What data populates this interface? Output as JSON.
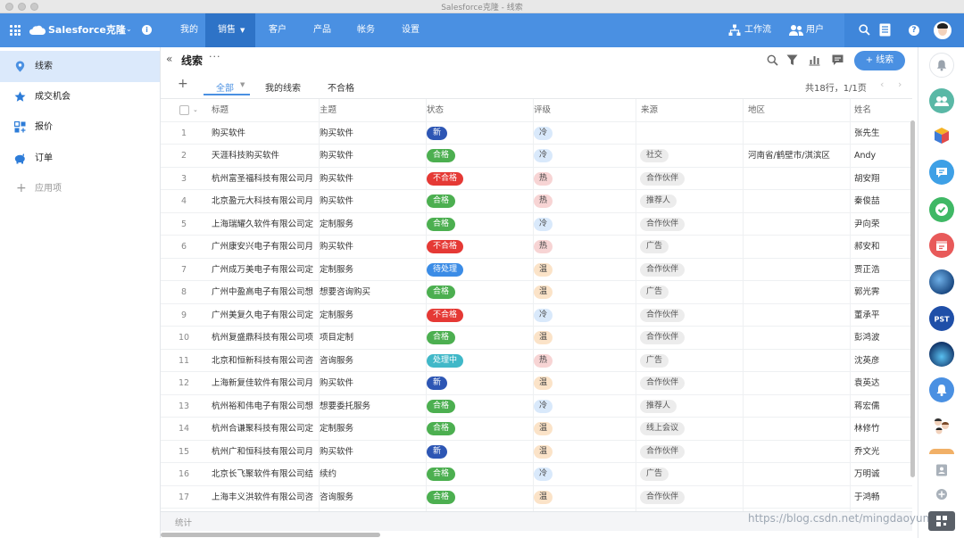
{
  "window": {
    "title": "Salesforce克隆 - 线索"
  },
  "topnav": {
    "brand": "Salesforce克隆",
    "items": [
      {
        "label": "我的"
      },
      {
        "label": "销售"
      },
      {
        "label": "客户"
      },
      {
        "label": "产品"
      },
      {
        "label": "帐务"
      },
      {
        "label": "设置"
      }
    ],
    "workflow": "工作流",
    "users": "用户",
    "info_glyph": "i",
    "help_glyph": "?",
    "accent": "#4a90e2"
  },
  "sidebar": {
    "items": [
      {
        "label": "线索",
        "icon": "location-pin-icon"
      },
      {
        "label": "成交机会",
        "icon": "star-icon"
      },
      {
        "label": "报价",
        "icon": "quote-icon"
      },
      {
        "label": "订单",
        "icon": "piggy-bank-icon"
      },
      {
        "label": "应用项",
        "icon": "plus-icon"
      }
    ]
  },
  "header": {
    "title": "线索",
    "new_button": "+ 线索",
    "page_info": "共18行，1/1页"
  },
  "tabs": [
    {
      "label": "全部"
    },
    {
      "label": "我的线索"
    },
    {
      "label": "不合格"
    }
  ],
  "table": {
    "columns": [
      "标题",
      "主题",
      "状态",
      "评级",
      "来源",
      "地区",
      "姓名"
    ],
    "rows": [
      {
        "n": "1",
        "title": "购买软件",
        "topic": "购买软件",
        "status": "新",
        "rating": "冷",
        "source": "",
        "region": "",
        "name": "张先生"
      },
      {
        "n": "2",
        "title": "天涯科技购买软件",
        "topic": "购买软件",
        "status": "合格",
        "rating": "冷",
        "source": "社交",
        "region": "河南省/鹤壁市/淇滨区",
        "name": "Andy"
      },
      {
        "n": "3",
        "title": "杭州富圣福科技有限公司月",
        "topic": "购买软件",
        "status": "不合格",
        "rating": "热",
        "source": "合作伙伴",
        "region": "",
        "name": "胡安翔"
      },
      {
        "n": "4",
        "title": "北京盈元大科技有限公司月",
        "topic": "购买软件",
        "status": "合格",
        "rating": "热",
        "source": "推荐人",
        "region": "",
        "name": "秦俊喆"
      },
      {
        "n": "5",
        "title": "上海瑞耀久软件有限公司定",
        "topic": "定制服务",
        "status": "合格",
        "rating": "冷",
        "source": "合作伙伴",
        "region": "",
        "name": "尹向荣"
      },
      {
        "n": "6",
        "title": "广州康安兴电子有限公司月",
        "topic": "购买软件",
        "status": "不合格",
        "rating": "热",
        "source": "广告",
        "region": "",
        "name": "郝安和"
      },
      {
        "n": "7",
        "title": "广州成万美电子有限公司定",
        "topic": "定制服务",
        "status": "待处理",
        "rating": "温",
        "source": "合作伙伴",
        "region": "",
        "name": "贾正浩"
      },
      {
        "n": "8",
        "title": "广州中盈高电子有限公司想",
        "topic": "想要咨询购买",
        "status": "合格",
        "rating": "温",
        "source": "广告",
        "region": "",
        "name": "郭光霁"
      },
      {
        "n": "9",
        "title": "广州美复久电子有限公司定",
        "topic": "定制服务",
        "status": "不合格",
        "rating": "冷",
        "source": "合作伙伴",
        "region": "",
        "name": "董承平"
      },
      {
        "n": "10",
        "title": "杭州复盛鼎科技有限公司项",
        "topic": "项目定制",
        "status": "合格",
        "rating": "温",
        "source": "合作伙伴",
        "region": "",
        "name": "彭鸿波"
      },
      {
        "n": "11",
        "title": "北京和恒新科技有限公司咨",
        "topic": "咨询服务",
        "status": "处理中",
        "rating": "热",
        "source": "广告",
        "region": "",
        "name": "沈英彦"
      },
      {
        "n": "12",
        "title": "上海新复佳软件有限公司月",
        "topic": "购买软件",
        "status": "新",
        "rating": "温",
        "source": "合作伙伴",
        "region": "",
        "name": "袁英达"
      },
      {
        "n": "13",
        "title": "杭州裕和伟电子有限公司想",
        "topic": "想要委托服务",
        "status": "合格",
        "rating": "冷",
        "source": "推荐人",
        "region": "",
        "name": "蒋宏儒"
      },
      {
        "n": "14",
        "title": "杭州合谦聚科技有限公司定",
        "topic": "定制服务",
        "status": "合格",
        "rating": "温",
        "source": "线上会议",
        "region": "",
        "name": "林修竹"
      },
      {
        "n": "15",
        "title": "杭州广和恒科技有限公司月",
        "topic": "购买软件",
        "status": "新",
        "rating": "温",
        "source": "合作伙伴",
        "region": "",
        "name": "乔文光"
      },
      {
        "n": "16",
        "title": "北京长飞聚软件有限公司结",
        "topic": "续约",
        "status": "合格",
        "rating": "冷",
        "source": "广告",
        "region": "",
        "name": "万明诚"
      },
      {
        "n": "17",
        "title": "上海丰义洪软件有限公司咨",
        "topic": "咨询服务",
        "status": "合格",
        "rating": "温",
        "source": "合作伙伴",
        "region": "",
        "name": "于鸿畅"
      }
    ]
  },
  "status_colors": {
    "新": "#2d56b4",
    "合格": "#4caf50",
    "不合格": "#e53935",
    "待处理": "#3b8ce6",
    "处理中": "#40b8c8"
  },
  "rating_colors": {
    "冷": "#d9e9fb",
    "热": "#f7d4d4",
    "温": "#fbe3c8"
  },
  "footer": {
    "label": "统计"
  },
  "watermark": "https://blog.csdn.net/mingdaoyun"
}
